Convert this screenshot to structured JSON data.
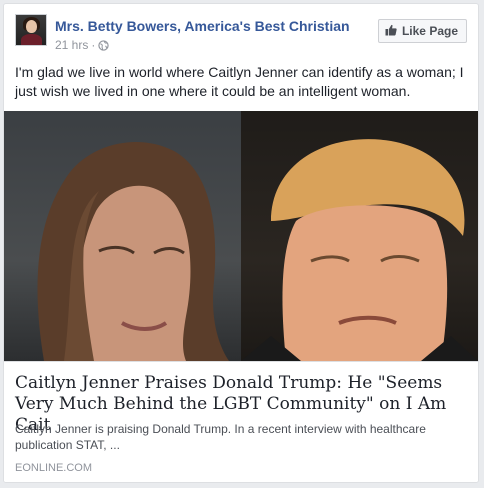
{
  "post": {
    "page_name": "Mrs. Betty Bowers, America's Best Christian",
    "timestamp": "21 hrs",
    "separator": "·",
    "privacy_icon": "globe-icon",
    "like_button_label": "Like Page",
    "like_button_icon": "thumbs-up-icon",
    "text": "I'm glad we live in world where Caitlyn Jenner can identify as a woman; I just wish we lived in one where it could be an intelligent woman."
  },
  "link": {
    "title": "Caitlyn Jenner Praises Donald Trump: He \"Seems Very Much Behind the LGBT Community\" on I Am Cait",
    "description": "Caitlyn Jenner is praising Donald Trump. In a recent interview with healthcare publication STAT, ...",
    "domain": "EONLINE.COM"
  },
  "colors": {
    "link_blue": "#365899",
    "meta_gray": "#90949c",
    "background": "#e9ebee"
  }
}
